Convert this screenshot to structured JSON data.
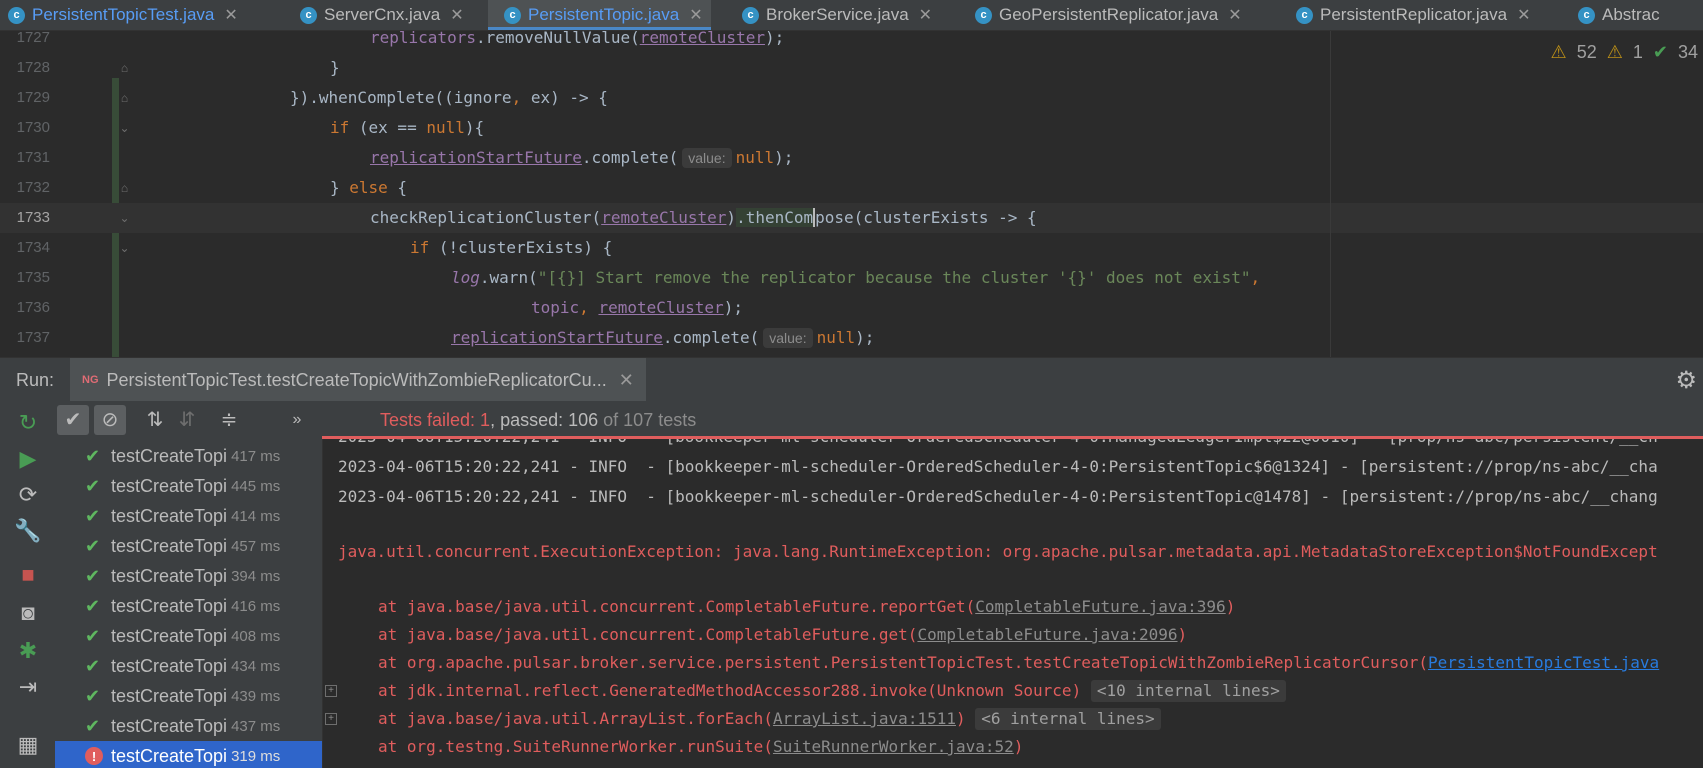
{
  "tabs": [
    {
      "label": "PersistentTopicTest.java",
      "active": false
    },
    {
      "label": "ServerCnx.java",
      "active": false
    },
    {
      "label": "PersistentTopic.java",
      "active": true
    },
    {
      "label": "BrokerService.java",
      "active": false
    },
    {
      "label": "GeoPersistentReplicator.java",
      "active": false
    },
    {
      "label": "PersistentReplicator.java",
      "active": false
    },
    {
      "label": "Abstrac",
      "active": false
    }
  ],
  "inspections": {
    "warnings": "52",
    "weak_warnings": "1",
    "ok": "34"
  },
  "editor": {
    "lines": [
      {
        "num": "1727",
        "text": "replicators.removeNullValue(remoteCluster);"
      },
      {
        "num": "1728",
        "text": "}"
      },
      {
        "num": "1729",
        "text": "}).whenComplete((ignore, ex) -> {"
      },
      {
        "num": "1730",
        "text": "if (ex == null){"
      },
      {
        "num": "1731",
        "text": "replicationStartFuture.complete( value: null);"
      },
      {
        "num": "1732",
        "text": "} else {"
      },
      {
        "num": "1733",
        "text": "checkReplicationCluster(remoteCluster).thenCompose(clusterExists -> {"
      },
      {
        "num": "1734",
        "text": "if (!clusterExists) {"
      },
      {
        "num": "1735",
        "text": "log.warn(\"[{}] Start remove the replicator because the cluster '{}' does not exist\","
      },
      {
        "num": "1736",
        "text": "topic, remoteCluster);"
      },
      {
        "num": "1737",
        "text": "replicationStartFuture.complete( value: null);"
      }
    ]
  },
  "run": {
    "label": "Run:",
    "config_name": "PersistentTopicTest.testCreateTopicWithZombieReplicatorCu...",
    "status_failed": "Tests failed: 1",
    "status_passed": ", passed: 106",
    "status_total": " of 107 tests"
  },
  "tests": [
    {
      "name": "testCreateTopi",
      "time": "417 ms",
      "status": "passed"
    },
    {
      "name": "testCreateTopi",
      "time": "445 ms",
      "status": "passed"
    },
    {
      "name": "testCreateTopi",
      "time": "414 ms",
      "status": "passed"
    },
    {
      "name": "testCreateTopi",
      "time": "457 ms",
      "status": "passed"
    },
    {
      "name": "testCreateTopi",
      "time": "394 ms",
      "status": "passed"
    },
    {
      "name": "testCreateTopi",
      "time": "416 ms",
      "status": "passed"
    },
    {
      "name": "testCreateTopi",
      "time": "408 ms",
      "status": "passed"
    },
    {
      "name": "testCreateTopi",
      "time": "434 ms",
      "status": "passed"
    },
    {
      "name": "testCreateTopi",
      "time": "439 ms",
      "status": "passed"
    },
    {
      "name": "testCreateTopi",
      "time": "437 ms",
      "status": "passed"
    },
    {
      "name": "testCreateTopi",
      "time": "319 ms",
      "status": "failed"
    }
  ],
  "console": {
    "line0": "2023-04-06T15:20:22,241 - INFO  - [bookkeeper-ml-scheduler-OrderedScheduler-4-0:ManagedLedgerImpl$22@0010] - [prop/ns-abc/persistent/__ch",
    "line1": "2023-04-06T15:20:22,241 - INFO  - [bookkeeper-ml-scheduler-OrderedScheduler-4-0:PersistentTopic$6@1324] - [persistent://prop/ns-abc/__cha",
    "line2": "2023-04-06T15:20:22,241 - INFO  - [bookkeeper-ml-scheduler-OrderedScheduler-4-0:PersistentTopic@1478] - [persistent://prop/ns-abc/__chang",
    "exception": "java.util.concurrent.ExecutionException: java.lang.RuntimeException: org.apache.pulsar.metadata.api.MetadataStoreException$NotFoundExcept",
    "st1_prefix": "at java.base/java.util.concurrent.CompletableFuture.reportGet(",
    "st1_link": "CompletableFuture.java:396",
    "st2_prefix": "at java.base/java.util.concurrent.CompletableFuture.get(",
    "st2_link": "CompletableFuture.java:2096",
    "st3_prefix": "at org.apache.pulsar.broker.service.persistent.PersistentTopicTest.testCreateTopicWithZombieReplicatorCursor(",
    "st3_link": "PersistentTopicTest.java",
    "st4_prefix": "at jdk.internal.reflect.GeneratedMethodAccessor288.invoke(Unknown Source)",
    "st4_fold": "<10 internal lines>",
    "st5_prefix": "at java.base/java.util.ArrayList.forEach(",
    "st5_link": "ArrayList.java:1511",
    "st5_fold": "<6 internal lines>",
    "st6_prefix": "at org.testng.SuiteRunnerWorker.runSuite(",
    "st6_link": "SuiteRunnerWorker.java:52"
  }
}
